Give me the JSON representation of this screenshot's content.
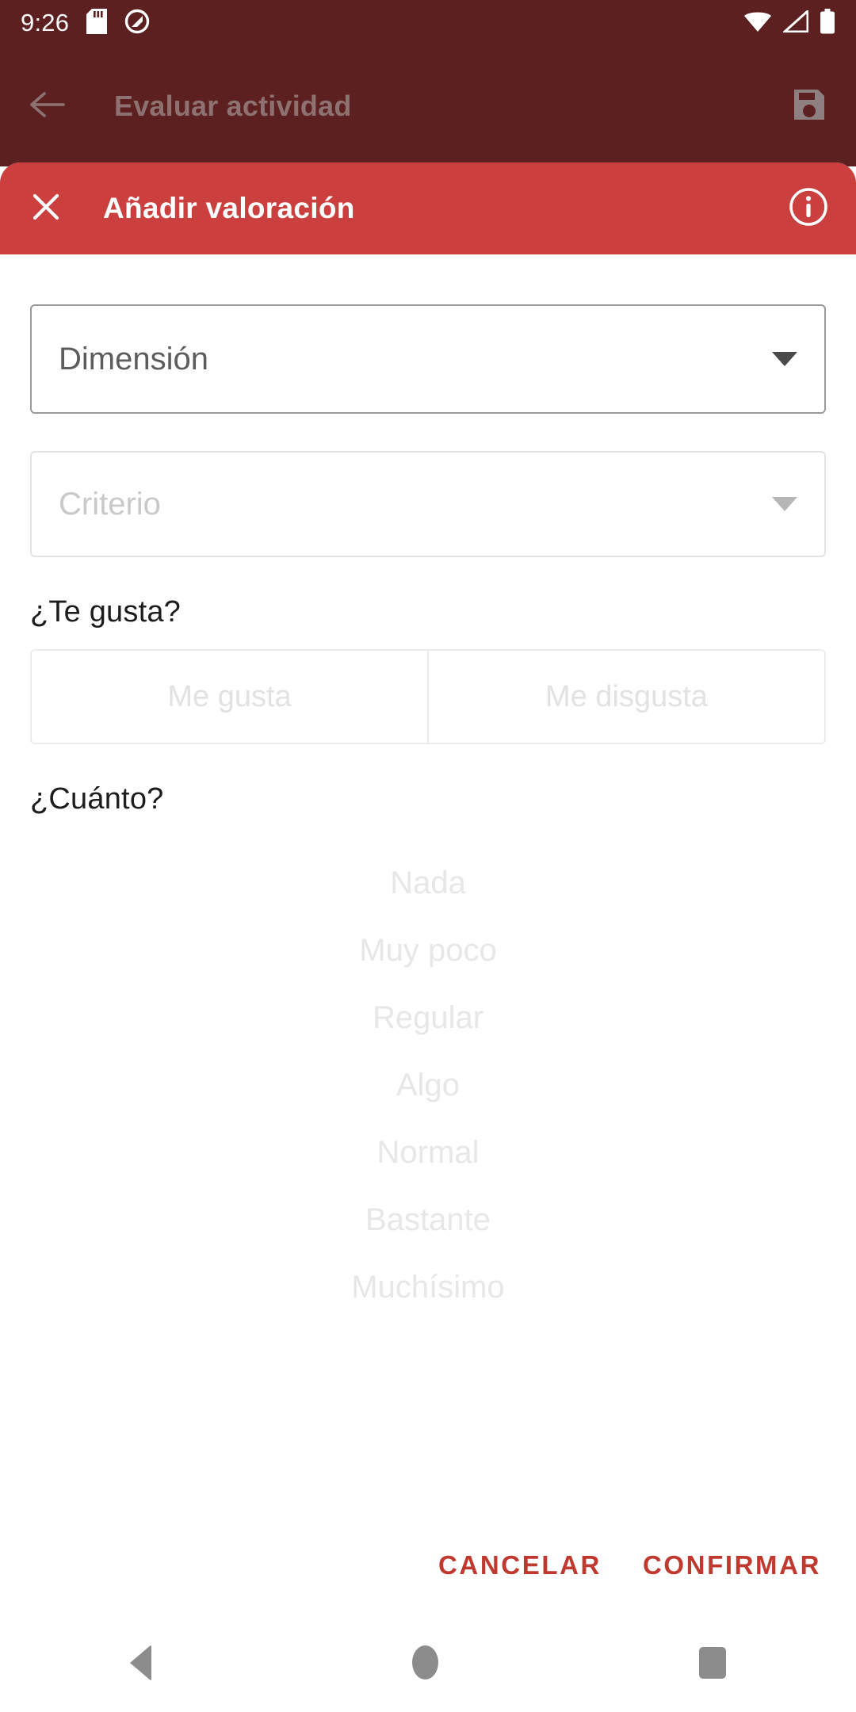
{
  "status_bar": {
    "time": "9:26",
    "icons_left": [
      "sd-card-icon",
      "rotation-lock-icon"
    ],
    "icons_right": [
      "wifi-icon",
      "cellular-signal-icon",
      "battery-icon"
    ]
  },
  "background_activity": {
    "back_icon": "back-arrow-icon",
    "title": "Evaluar actividad",
    "save_icon": "save-floppy-icon"
  },
  "dialog": {
    "close_icon": "close-x-icon",
    "title": "Añadir valoración",
    "info_icon": "info-circle-icon",
    "dimension_select": {
      "label": "Dimensión",
      "caret_icon": "chevron-down-icon",
      "enabled": true
    },
    "criterio_select": {
      "label": "Criterio",
      "caret_icon": "chevron-down-icon",
      "enabled": false
    },
    "like_question": {
      "label": "¿Te gusta?",
      "options": [
        {
          "label": "Me gusta"
        },
        {
          "label": "Me disgusta"
        }
      ]
    },
    "amount_question": {
      "label": "¿Cuánto?",
      "options": [
        {
          "label": "Nada"
        },
        {
          "label": "Muy poco"
        },
        {
          "label": "Regular"
        },
        {
          "label": "Algo"
        },
        {
          "label": "Normal"
        },
        {
          "label": "Bastante"
        },
        {
          "label": "Muchísimo"
        }
      ]
    },
    "actions": {
      "cancel": "CANCELAR",
      "confirm": "CONFIRMAR"
    }
  },
  "nav_bar": {
    "back_icon": "nav-back-triangle-icon",
    "home_icon": "nav-home-circle-icon",
    "recents_icon": "nav-recents-square-icon"
  },
  "colors": {
    "header_red": "#cb3f3f",
    "background_maroon": "#5d2020",
    "action_red": "#c0392f",
    "disabled_gray": "#e7e7e7"
  }
}
